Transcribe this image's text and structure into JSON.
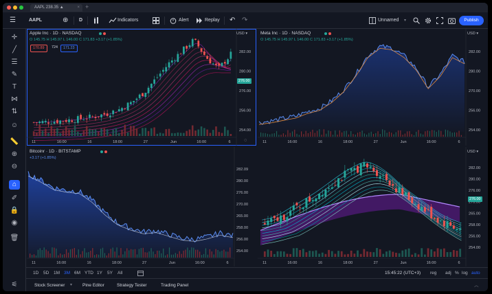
{
  "browser": {
    "tab_title": "AAPL 238.35 ▲",
    "tab_close": "×",
    "new_tab": "+",
    "dot_colors": [
      "#ff5f57",
      "#febc2e",
      "#28c840"
    ]
  },
  "toolbar": {
    "menu_icon": "☰",
    "symbol": "AAPL",
    "add_symbol": "⊕",
    "interval": "D",
    "chart_type_icon": "📊",
    "indicators": "Indicators",
    "layout_icon": "▦",
    "alert": "Alert",
    "replay": "Replay",
    "undo": "↶",
    "redo": "↷",
    "layout_name": "Unnamed",
    "publish": "Publish"
  },
  "colors": {
    "up": "#26a69a",
    "down": "#ef5350",
    "accent": "#2962ff",
    "line": "#5b8def"
  },
  "panes": [
    {
      "id": "apple",
      "title": "Apple Inc · 1D · NASDAQ",
      "ohlc": "O 145.75  H 145.97  L 146.00  C 171.83 +3.17 (+1.85%)",
      "sell": "170.89",
      "spread": "724",
      "buy": "171.23",
      "currency": "USD ▾",
      "last_price": "276.00",
      "yticks": [
        "282.00",
        "280.00",
        "276.00",
        "256.00",
        "254.00"
      ],
      "xticks": [
        "11",
        "16:00",
        "16",
        "18:00",
        "27",
        "Jun",
        "16:00",
        "6"
      ]
    },
    {
      "id": "meta",
      "title": "Meta Inc · 1D · NASDAQ",
      "ohlc": "O 145.75  H 145.97  L 146.00  C 171.83 +3.17 (+1.85%)",
      "currency": "USD ▾",
      "yticks": [
        "282.00",
        "280.00",
        "270.00",
        "256.00",
        "254.00"
      ],
      "xticks": [
        "11",
        "16:00",
        "16",
        "18:00",
        "27",
        "Jun",
        "16:00",
        "6"
      ]
    },
    {
      "id": "bitcoin",
      "title": "Bitcoinr · 1D · BITSTAMP",
      "ohlc": "+3.17 (+1.85%)",
      "currency": "",
      "yticks": [],
      "xticks": [
        "11",
        "16:00",
        "16",
        "18:00",
        "27",
        "Jun",
        "16:00",
        "6"
      ]
    },
    {
      "id": "fourth",
      "currency": "USD ▾",
      "last_price": "276.00",
      "yticks": [
        "282.00",
        "280.00",
        "276.00",
        "270.00",
        "265.00",
        "258.00",
        "256.00",
        "254.00"
      ],
      "xticks": [
        "11",
        "16:00",
        "16",
        "18:00",
        "27",
        "Jun",
        "16:00",
        "6"
      ]
    }
  ],
  "middle_axis": {
    "ticks": [
      "282.09",
      "280.00",
      "276.00",
      "270.00",
      "265.00",
      "258.00",
      "256.00",
      "254.00"
    ]
  },
  "bottom": {
    "ranges": [
      "1D",
      "5D",
      "1M",
      "3M",
      "6M",
      "YTD",
      "1Y",
      "5Y",
      "All"
    ],
    "active_range": "3M",
    "time": "15:45:22 (UTC+3)",
    "options": [
      "reg",
      "adj",
      "%",
      "log",
      "auto"
    ]
  },
  "panel_tabs": [
    "Stock Screener",
    "Pine Editor",
    "Strategy Tester",
    "Trading Panel"
  ],
  "chart_data": [
    {
      "type": "candlestick",
      "pane": "apple",
      "x": [
        "11",
        "16:00",
        "16",
        "18:00",
        "27",
        "Jun",
        "16:00",
        "6"
      ],
      "close_path_values": [
        254.4,
        254.6,
        254.9,
        255.3,
        255.8,
        256.5,
        257.5,
        259.0,
        261.5,
        265.0,
        270.0,
        275.0,
        279.0,
        283.0,
        277.0,
        273.0,
        278.0
      ],
      "ylim": [
        253.5,
        284.0
      ]
    },
    {
      "type": "line",
      "pane": "meta",
      "x": [
        "11",
        "16:00",
        "16",
        "18:00",
        "27",
        "Jun",
        "16:00",
        "6"
      ],
      "values": [
        256.5,
        257.0,
        257.8,
        258.5,
        260.0,
        261.0,
        263.5,
        267.0,
        272.0,
        278.0,
        281.0,
        280.5,
        278.0,
        274.0,
        268.0,
        272.0,
        278.0,
        276.0
      ],
      "ylim": [
        253.5,
        284.0
      ]
    },
    {
      "type": "area",
      "pane": "bitcoin",
      "x": [
        "11",
        "16:00",
        "16",
        "18:00",
        "27",
        "Jun",
        "16:00",
        "6"
      ],
      "values": [
        281.5,
        279.0,
        276.0,
        275.0,
        274.5,
        271.0,
        266.0,
        262.0,
        260.0,
        258.5,
        259.0,
        257.5,
        256.0,
        255.5,
        256.5,
        258.0,
        257.0
      ],
      "ylim": [
        254.0,
        284.0
      ]
    },
    {
      "type": "candlestick",
      "pane": "fourth",
      "x": [
        "11",
        "16:00",
        "16",
        "18:00",
        "27",
        "Jun",
        "16:00",
        "6"
      ],
      "close_path_values": [
        262.0,
        263.5,
        266.0,
        268.5,
        271.0,
        274.0,
        277.0,
        279.5,
        281.5,
        280.0,
        277.0,
        273.0,
        270.0,
        267.0,
        264.0,
        262.0,
        260.5
      ],
      "ylim": [
        253.5,
        284.0
      ]
    }
  ]
}
